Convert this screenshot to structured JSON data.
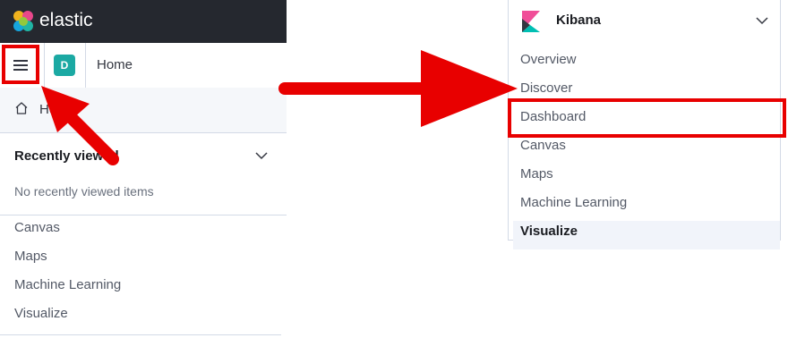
{
  "app": {
    "brand": "elastic",
    "space_initial": "D",
    "breadcrumb": "Home"
  },
  "left_nav": {
    "home_label": "Home",
    "recently_viewed_title": "Recently viewed",
    "recently_viewed_empty": "No recently viewed items",
    "items": [
      {
        "label": "Canvas"
      },
      {
        "label": "Maps"
      },
      {
        "label": "Machine Learning"
      },
      {
        "label": "Visualize"
      }
    ]
  },
  "kibana_nav": {
    "title": "Kibana",
    "items": [
      {
        "label": "Overview"
      },
      {
        "label": "Discover"
      },
      {
        "label": "Dashboard"
      },
      {
        "label": "Canvas"
      },
      {
        "label": "Maps"
      },
      {
        "label": "Machine Learning"
      },
      {
        "label": "Visualize"
      }
    ]
  },
  "colors": {
    "annotation_red": "#e80000",
    "topbar": "#25282f",
    "space_avatar": "#1ba9a3"
  },
  "icons": [
    "elastic-logo-icon",
    "menu-icon",
    "home-icon",
    "chevron-down-icon",
    "kibana-logo-icon"
  ]
}
